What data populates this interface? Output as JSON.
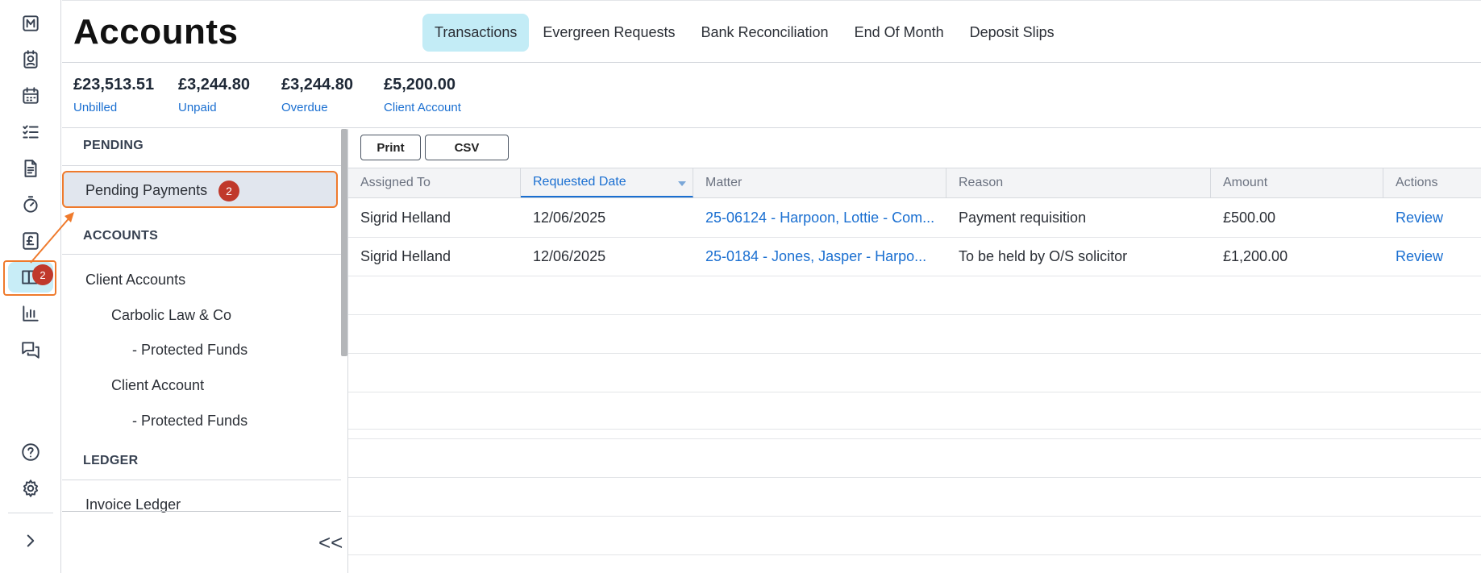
{
  "rail": {
    "icons": [
      "matter-icon",
      "contacts-icon",
      "calendar-icon",
      "tasks-icon",
      "documents-icon",
      "timer-icon",
      "billing-icon",
      "accounts-icon",
      "reports-icon",
      "messages-icon",
      "help-icon",
      "settings-icon",
      "expand-icon"
    ],
    "accounts_badge": "2"
  },
  "header": {
    "title": "Accounts",
    "tabs": [
      {
        "label": "Transactions",
        "active": true
      },
      {
        "label": "Evergreen Requests",
        "active": false
      },
      {
        "label": "Bank Reconciliation",
        "active": false
      },
      {
        "label": "End Of Month",
        "active": false
      },
      {
        "label": "Deposit Slips",
        "active": false
      }
    ]
  },
  "stats": [
    {
      "value": "£23,513.51",
      "label": "Unbilled"
    },
    {
      "value": "£3,244.80",
      "label": "Unpaid"
    },
    {
      "value": "£3,244.80",
      "label": "Overdue"
    },
    {
      "value": "£5,200.00",
      "label": "Client Account"
    }
  ],
  "nav": {
    "pending_heading": "PENDING",
    "pending_payments": "Pending Payments",
    "pending_badge": "2",
    "accounts_heading": "ACCOUNTS",
    "client_accounts": "Client Accounts",
    "carbolic": "Carbolic Law & Co",
    "protected_1": "- Protected Funds",
    "client_account": "Client Account",
    "protected_2": "- Protected Funds",
    "ledger_heading": "LEDGER",
    "invoice_ledger": "Invoice Ledger",
    "collapse": "<<"
  },
  "toolbar": {
    "print": "Print",
    "csv": "CSV"
  },
  "table": {
    "columns": [
      "Assigned To",
      "Requested Date",
      "Matter",
      "Reason",
      "Amount",
      "Actions"
    ],
    "sorted_column": "Requested Date",
    "rows": [
      {
        "assigned": "Sigrid Helland",
        "date": "12/06/2025",
        "matter": "25-06124 - Harpoon, Lottie - Com...",
        "reason": "Payment requisition",
        "amount": "£500.00",
        "action": "Review"
      },
      {
        "assigned": "Sigrid Helland",
        "date": "12/06/2025",
        "matter": "25-0184 - Jones, Jasper - Harpo...",
        "reason": "To be held by O/S solicitor",
        "amount": "£1,200.00",
        "action": "Review"
      }
    ]
  },
  "colors": {
    "accent": "#1a6fd1",
    "active_tab": "#c3ecf6",
    "badge": "#c0392b",
    "highlight": "#ef7a2c"
  }
}
